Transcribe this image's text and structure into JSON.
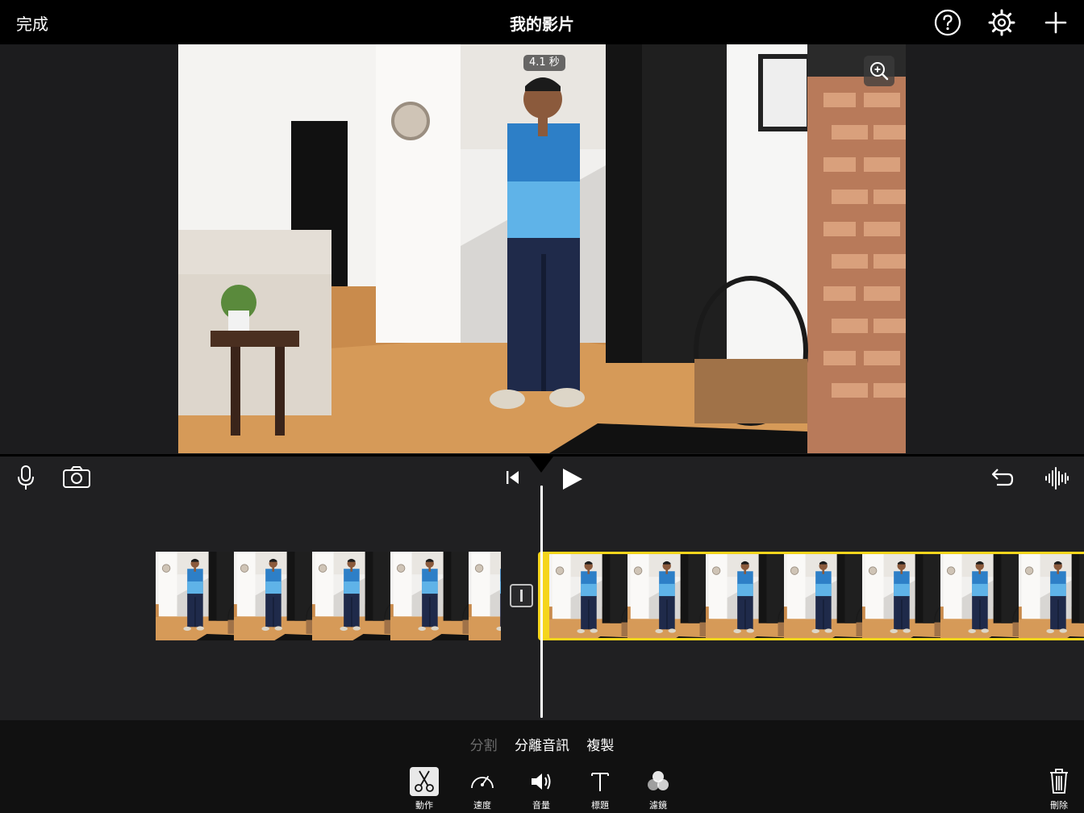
{
  "topbar": {
    "done_label": "完成",
    "project_title": "我的影片",
    "icons": [
      "help-icon",
      "settings-gear-icon",
      "plus-icon"
    ]
  },
  "viewer": {
    "clip_duration_badge": "4.1 秒",
    "zoom_icon": "zoom-in-icon"
  },
  "timeline": {
    "left_icons": [
      "microphone-icon",
      "camera-icon"
    ],
    "transport_icons": [
      "skip-to-start-icon",
      "play-icon"
    ],
    "right_icons": [
      "undo-icon",
      "audio-waveform-icon"
    ],
    "clips": [
      {
        "name": "clip-1",
        "selected": false
      },
      {
        "name": "clip-2",
        "selected": true
      }
    ],
    "selection_color": "#f5d51c"
  },
  "bottombar": {
    "actions": [
      {
        "label": "分割",
        "enabled": false
      },
      {
        "label": "分離音訊",
        "enabled": true
      },
      {
        "label": "複製",
        "enabled": true
      }
    ],
    "tools": [
      {
        "label": "動作",
        "icon": "scissors-icon",
        "active": true
      },
      {
        "label": "速度",
        "icon": "speedometer-icon",
        "active": false
      },
      {
        "label": "音量",
        "icon": "speaker-icon",
        "active": false
      },
      {
        "label": "標題",
        "icon": "text-icon",
        "active": false
      },
      {
        "label": "濾鏡",
        "icon": "filters-icon",
        "active": false
      }
    ],
    "delete_label": "刪除"
  }
}
